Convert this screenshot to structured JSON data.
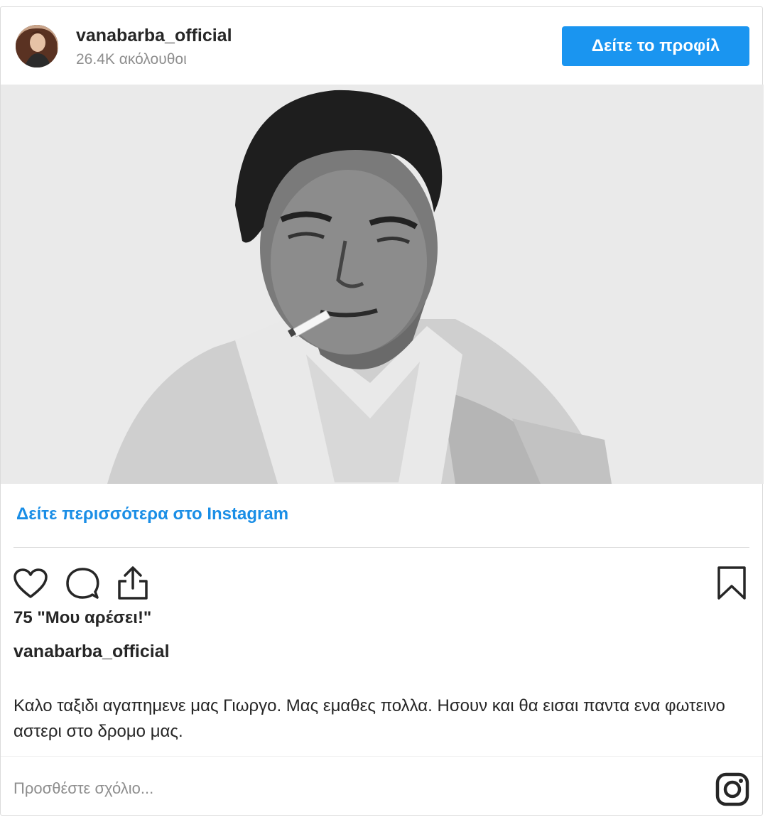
{
  "header": {
    "username": "vanabarba_official",
    "followers": "26.4K ακόλουθοι",
    "profile_button": "Δείτε το προφίλ"
  },
  "post": {
    "see_more_link": "Δείτε περισσότερα στο Instagram",
    "likes": "75 \"Μου αρέσει!\"",
    "caption_user": "vanabarba_official",
    "caption_text": "Καλο ταξιδι αγαπημενε μας Γιωργο. Μας εμαθες πολλα. Ησουν και θα εισαι παντα ενα φωτεινο αστερι στο δρομο μας."
  },
  "icons": {
    "like": "heart-icon",
    "comment": "comment-icon",
    "share": "share-icon",
    "save": "bookmark-icon",
    "instagram": "instagram-icon"
  },
  "comment_box": {
    "placeholder": "Προσθέστε σχόλιο..."
  },
  "colors": {
    "accent": "#1a95f0",
    "link": "#1a8ee6",
    "muted": "#8e8e8e",
    "text": "#262626"
  }
}
